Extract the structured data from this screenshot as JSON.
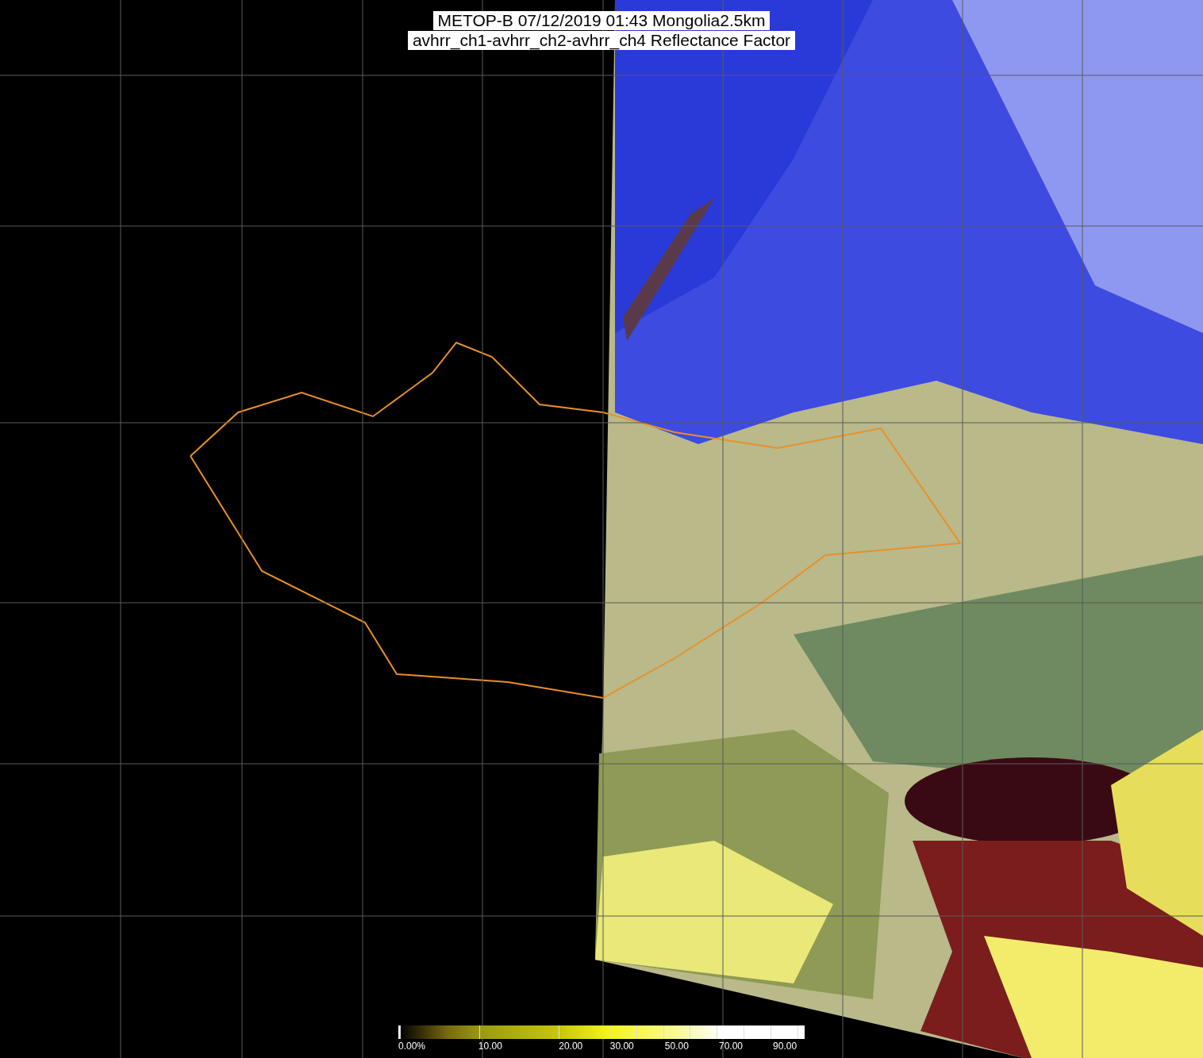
{
  "title": {
    "lines": [
      "METOP-B 07/12/2019 01:43 Mongolia2.5km",
      "avhrr_ch1-avhrr_ch2-avhrr_ch4 Reflectance Factor"
    ]
  },
  "colorbar": {
    "labels": [
      "0.00%",
      "10.00",
      "20.00",
      "30.00",
      "50.00",
      "70.00",
      "90.00"
    ]
  }
}
